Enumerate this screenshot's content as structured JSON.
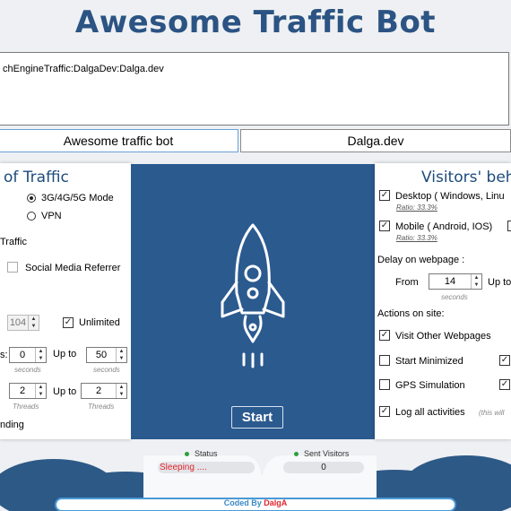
{
  "header": {
    "title": "Awesome Traffic Bot"
  },
  "keywords": {
    "text": "chEngineTraffic:DalgaDev:Dalga.dev"
  },
  "buttons": {
    "left": "Awesome traffic bot",
    "right": "Dalga.dev",
    "start": "Start"
  },
  "left_panel": {
    "title": "of Traffic",
    "radio_mobile": "3G/4G/5G Mode",
    "radio_vpn": "VPN",
    "traffic_label": "Traffic",
    "social_referrer": "Social Media Referrer",
    "count_value": "104",
    "unlimited": "Unlimited",
    "seconds_prefix": "s:",
    "from_seconds": "0",
    "up_to": "Up to",
    "to_seconds": "50",
    "seconds_caption": "seconds",
    "threads_from": "2",
    "threads_to": "2",
    "threads_caption": "Threads",
    "bottom_label": "nding"
  },
  "right_panel": {
    "title": "Visitors' beh",
    "desktop": "Desktop ( Windows, Linu",
    "desktop_ratio": "Ratio: 33.3%",
    "mobile": "Mobile ( Android, IOS)",
    "mobile_ratio": "Ratio: 33.3%",
    "delay_label": "Delay on webpage :",
    "from": "From",
    "delay_from": "14",
    "up_to": "Up to",
    "seconds_caption": "seconds",
    "actions_label": "Actions on site:",
    "visit_other": "Visit Other Webpages",
    "start_minimized": "Start Minimized",
    "gps_simulation": "GPS Simulation",
    "log_all": "Log all activities",
    "log_hint": "(this will"
  },
  "status": {
    "status_label": "Status",
    "status_value": "Sleeping ....",
    "sent_label": "Sent Visitors",
    "sent_value": "0"
  },
  "footer": {
    "coded_by": "Coded By ",
    "author": "DalgA"
  },
  "colors": {
    "title": "#2b5383",
    "panel_blue": "#2b5a8f",
    "status_red": "#e0242b",
    "dot_green": "#2e9e3c"
  }
}
